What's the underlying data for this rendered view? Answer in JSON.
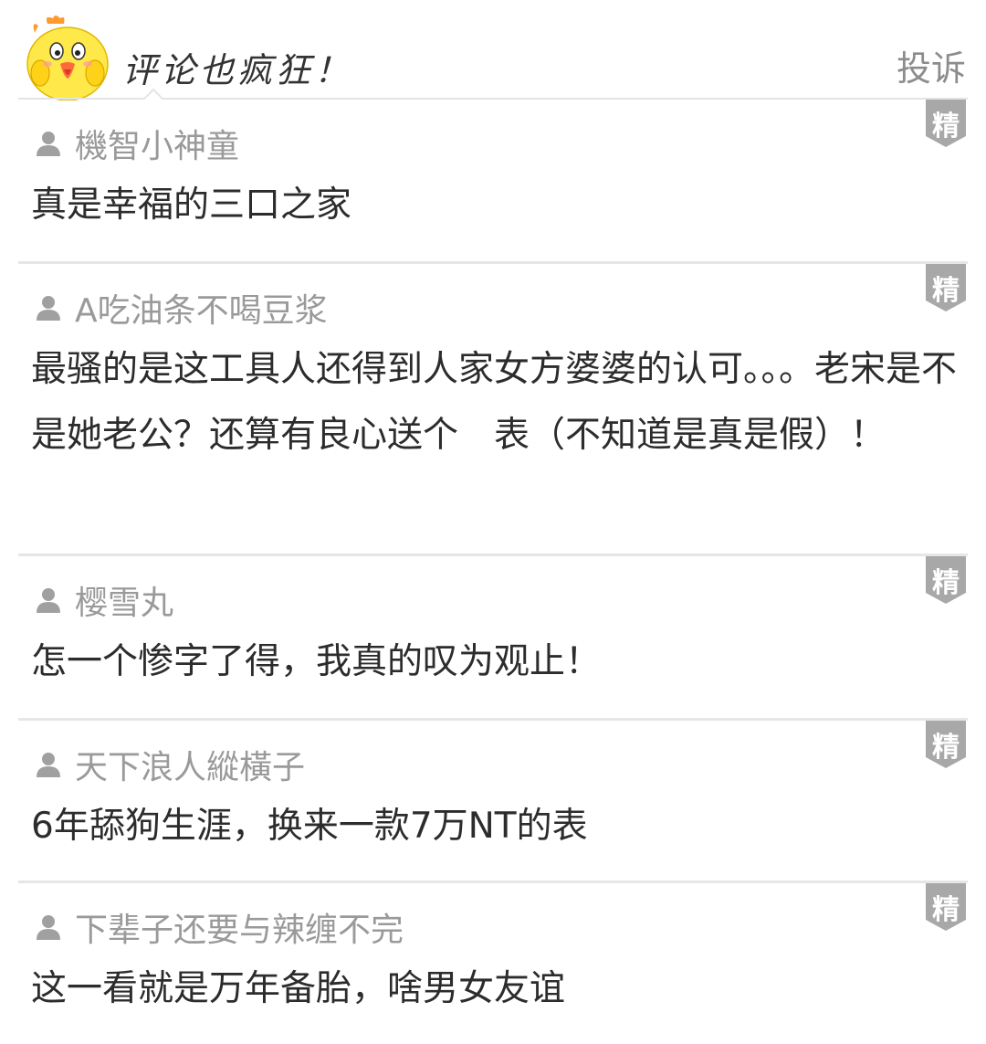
{
  "header": {
    "title": "评论也疯狂！",
    "report_label": "投诉",
    "mascot_icon": "yellow-chick-mascot"
  },
  "badge_label": "精",
  "colors": {
    "divider": "#e6e6e6",
    "badge": "#a8a8a8",
    "username": "#9a9a9a",
    "text": "#2c2c2c",
    "report": "#8c8c8c",
    "mascot_yellow": "#ffe84a",
    "mascot_orange": "#ff8a1f"
  },
  "comments": [
    {
      "username": "機智小神童",
      "text": "真是幸福的三口之家"
    },
    {
      "username": "A吃油条不喝豆浆",
      "text": "最骚的是这工具人还得到人家女方婆婆的认可。。。老宋是不是她老公？还算有良心送个　表（不知道是真是假）！"
    },
    {
      "username": "樱雪丸",
      "text": "怎一个惨字了得，我真的叹为观止！"
    },
    {
      "username": "天下浪人縱橫子",
      "text": "6年舔狗生涯，换来一款7万NT的表"
    },
    {
      "username": "下辈子还要与辣缠不完",
      "text": "这一看就是万年备胎，啥男女友谊"
    }
  ]
}
